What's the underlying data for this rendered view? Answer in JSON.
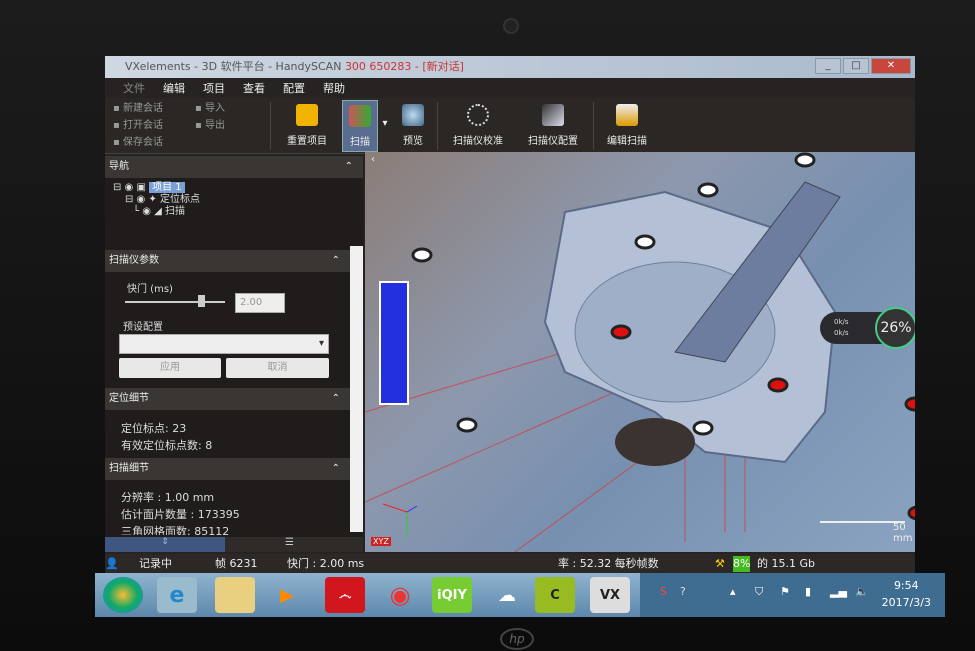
{
  "window": {
    "title_prefix": "VXelements - 3D 软件平台 - HandySCAN ",
    "title_serial": "300 650283",
    "title_session": " - [新对话]",
    "buttons": [
      "_",
      "□",
      "✕"
    ]
  },
  "menu": [
    "文件",
    "编辑",
    "项目",
    "查看",
    "配置",
    "帮助"
  ],
  "ribbon": {
    "session": [
      "新建会话",
      "打开会话",
      "保存会话"
    ],
    "io": [
      "导入",
      "导出"
    ],
    "reset": "重置项目",
    "scan": "扫描",
    "dropdown": "▾",
    "preview": "预览",
    "calibrate": "扫描仪校准",
    "config": "扫描仪配置",
    "edit_scan": "编辑扫描"
  },
  "nav": {
    "title": "导航",
    "project": "项目 1",
    "targets": "定位标点",
    "scan": "扫描"
  },
  "scanner_params": {
    "title": "扫描仪参数",
    "shutter_label": "快门 (ms)",
    "shutter_value": "2.00",
    "shutter_fraction": 0.8,
    "preset_label": "预设配置",
    "preset_value": "",
    "apply": "应用",
    "cancel": "取消"
  },
  "positioning": {
    "title": "定位细节",
    "targets": "定位标点: 23",
    "valid_targets": "有效定位标点数: 8"
  },
  "scan_details": {
    "title": "扫描细节",
    "resolution": "分辨率 : 1.00 mm",
    "facets": "估计面片数量 : 173395",
    "triangles": "三角网格面数: 85112"
  },
  "viewport": {
    "progress": "26%",
    "rate1": "0k/s",
    "rate2": "0k/s",
    "scale": "50 mm",
    "axes": "XYZ"
  },
  "status": {
    "recording": "记录中",
    "frame": "帧 6231",
    "shutter": "快门 : 2.00 ms",
    "rate": "率 : 52.32 每秒帧数",
    "memory_pct": "8%",
    "memory_text": " 的 15.1 Gb"
  },
  "taskbar": {
    "apps": [
      "开始",
      "IE",
      "文件夹",
      "播放器",
      "网易云音乐",
      "Chrome",
      "爱奇艺",
      "百度云",
      "CDS",
      "VX"
    ],
    "time": "9:54",
    "date": "2017/3/3"
  },
  "colors": {
    "accent": "#5a6c90",
    "selected": "#7aa0d8",
    "marker": "#e01010"
  }
}
